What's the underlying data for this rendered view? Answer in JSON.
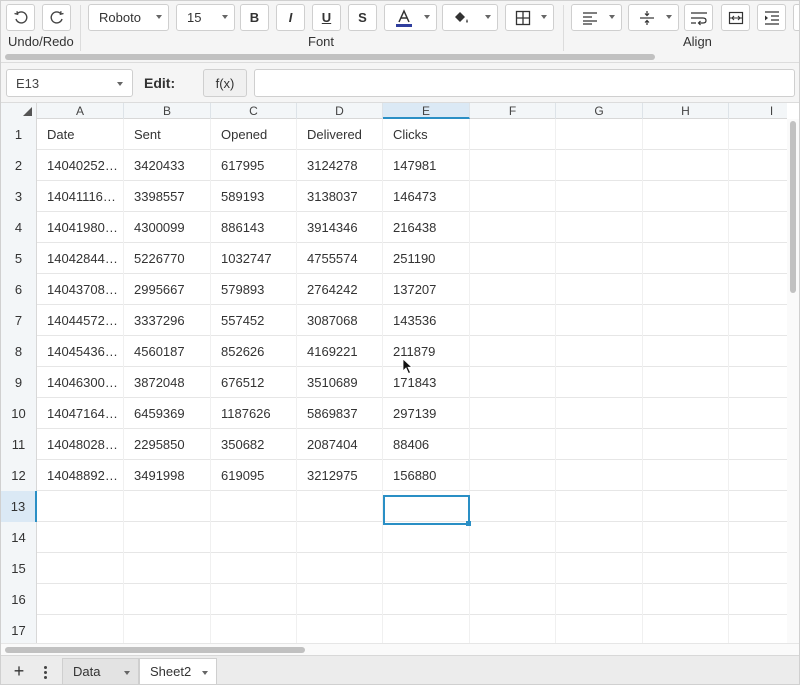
{
  "toolbar": {
    "undo_redo_label": "Undo/Redo",
    "font_label": "Font",
    "align_label": "Align",
    "font_family": "Roboto",
    "font_size": "15",
    "bold_label": "B",
    "italic_label": "I",
    "underline_label": "U",
    "strike_label": "S"
  },
  "formula_bar": {
    "name_box": "E13",
    "edit_label": "Edit:",
    "fx_label": "f(x)",
    "formula_value": ""
  },
  "grid": {
    "columns": [
      "A",
      "B",
      "C",
      "D",
      "E",
      "F",
      "G",
      "H",
      "I"
    ],
    "selected_column": "E",
    "selected_row": "13",
    "rows": [
      {
        "num": "1",
        "cells": [
          "Date",
          "Sent",
          "Opened",
          "Delivered",
          "Clicks"
        ]
      },
      {
        "num": "2",
        "cells": [
          "14040252…",
          "3420433",
          "617995",
          "3124278",
          "147981"
        ]
      },
      {
        "num": "3",
        "cells": [
          "14041116…",
          "3398557",
          "589193",
          "3138037",
          "146473"
        ]
      },
      {
        "num": "4",
        "cells": [
          "14041980…",
          "4300099",
          "886143",
          "3914346",
          "216438"
        ]
      },
      {
        "num": "5",
        "cells": [
          "14042844…",
          "5226770",
          "1032747",
          "4755574",
          "251190"
        ]
      },
      {
        "num": "6",
        "cells": [
          "14043708…",
          "2995667",
          "579893",
          "2764242",
          "137207"
        ]
      },
      {
        "num": "7",
        "cells": [
          "14044572…",
          "3337296",
          "557452",
          "3087068",
          "143536"
        ]
      },
      {
        "num": "8",
        "cells": [
          "14045436…",
          "4560187",
          "852626",
          "4169221",
          "211879"
        ]
      },
      {
        "num": "9",
        "cells": [
          "14046300…",
          "3872048",
          "676512",
          "3510689",
          "171843"
        ]
      },
      {
        "num": "10",
        "cells": [
          "14047164…",
          "6459369",
          "1187626",
          "5869837",
          "297139"
        ]
      },
      {
        "num": "11",
        "cells": [
          "14048028…",
          "2295850",
          "350682",
          "2087404",
          "88406"
        ]
      },
      {
        "num": "12",
        "cells": [
          "14048892…",
          "3491998",
          "619095",
          "3212975",
          "156880"
        ]
      },
      {
        "num": "13",
        "cells": [
          "",
          "",
          "",
          "",
          ""
        ]
      },
      {
        "num": "14",
        "cells": [
          "",
          "",
          "",
          "",
          ""
        ]
      },
      {
        "num": "15",
        "cells": [
          "",
          "",
          "",
          "",
          ""
        ]
      },
      {
        "num": "16",
        "cells": [
          "",
          "",
          "",
          "",
          ""
        ]
      },
      {
        "num": "17",
        "cells": [
          "",
          "",
          "",
          "",
          ""
        ]
      }
    ]
  },
  "sheets": {
    "add_label": "+",
    "tabs": [
      {
        "label": "Data",
        "active": false
      },
      {
        "label": "Sheet2",
        "active": true
      }
    ]
  },
  "colors": {
    "accent": "#2a8fc5",
    "header_bg": "#f3f6f8",
    "selected_header_bg": "#dbe9f5"
  }
}
